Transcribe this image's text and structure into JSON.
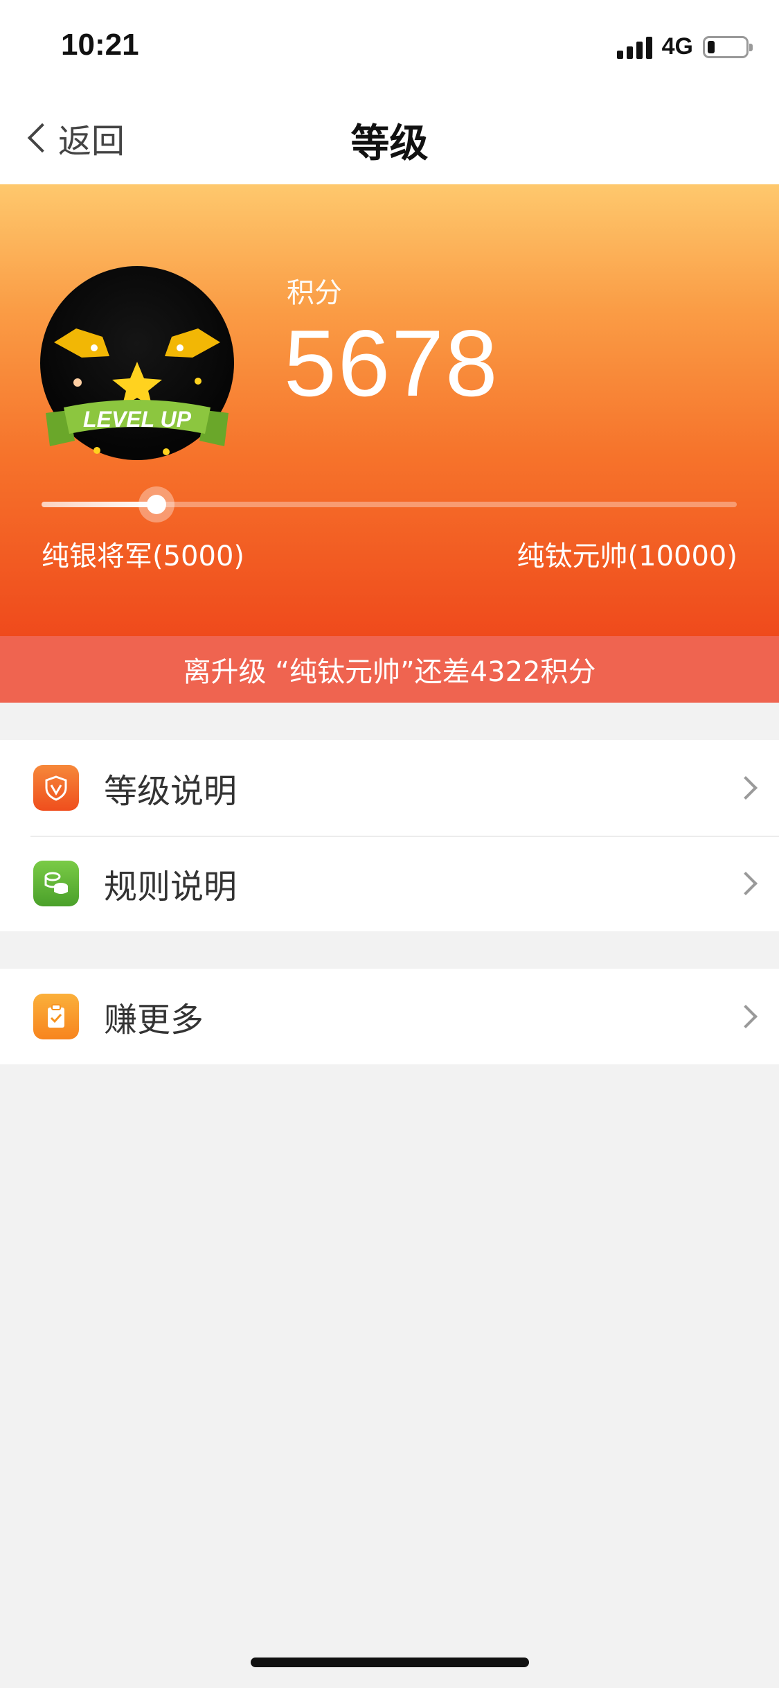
{
  "status_bar": {
    "time": "10:21",
    "network": "4G",
    "battery_fraction": 0.18
  },
  "nav": {
    "back_label": "返回",
    "title": "等级"
  },
  "hero": {
    "points_label": "积分",
    "points_value": "5678",
    "avatar_badge_text": "LEVEL UP",
    "progress_fraction": 0.165,
    "level_start": "纯银将军(5000)",
    "level_end": "纯钛元帅(10000)",
    "colors": {
      "top": "#fec86d",
      "bottom": "#ef4a1c"
    }
  },
  "notice": "离升级 “纯钛元帅”还差4322积分",
  "menu": {
    "group1": [
      {
        "label": "等级说明",
        "icon": "shield-icon",
        "color": "#f15a24"
      },
      {
        "label": "规则说明",
        "icon": "coins-icon",
        "color": "#58b435"
      }
    ],
    "group2": [
      {
        "label": "赚更多",
        "icon": "clipboard-check-icon",
        "color": "#f7931e"
      }
    ]
  }
}
